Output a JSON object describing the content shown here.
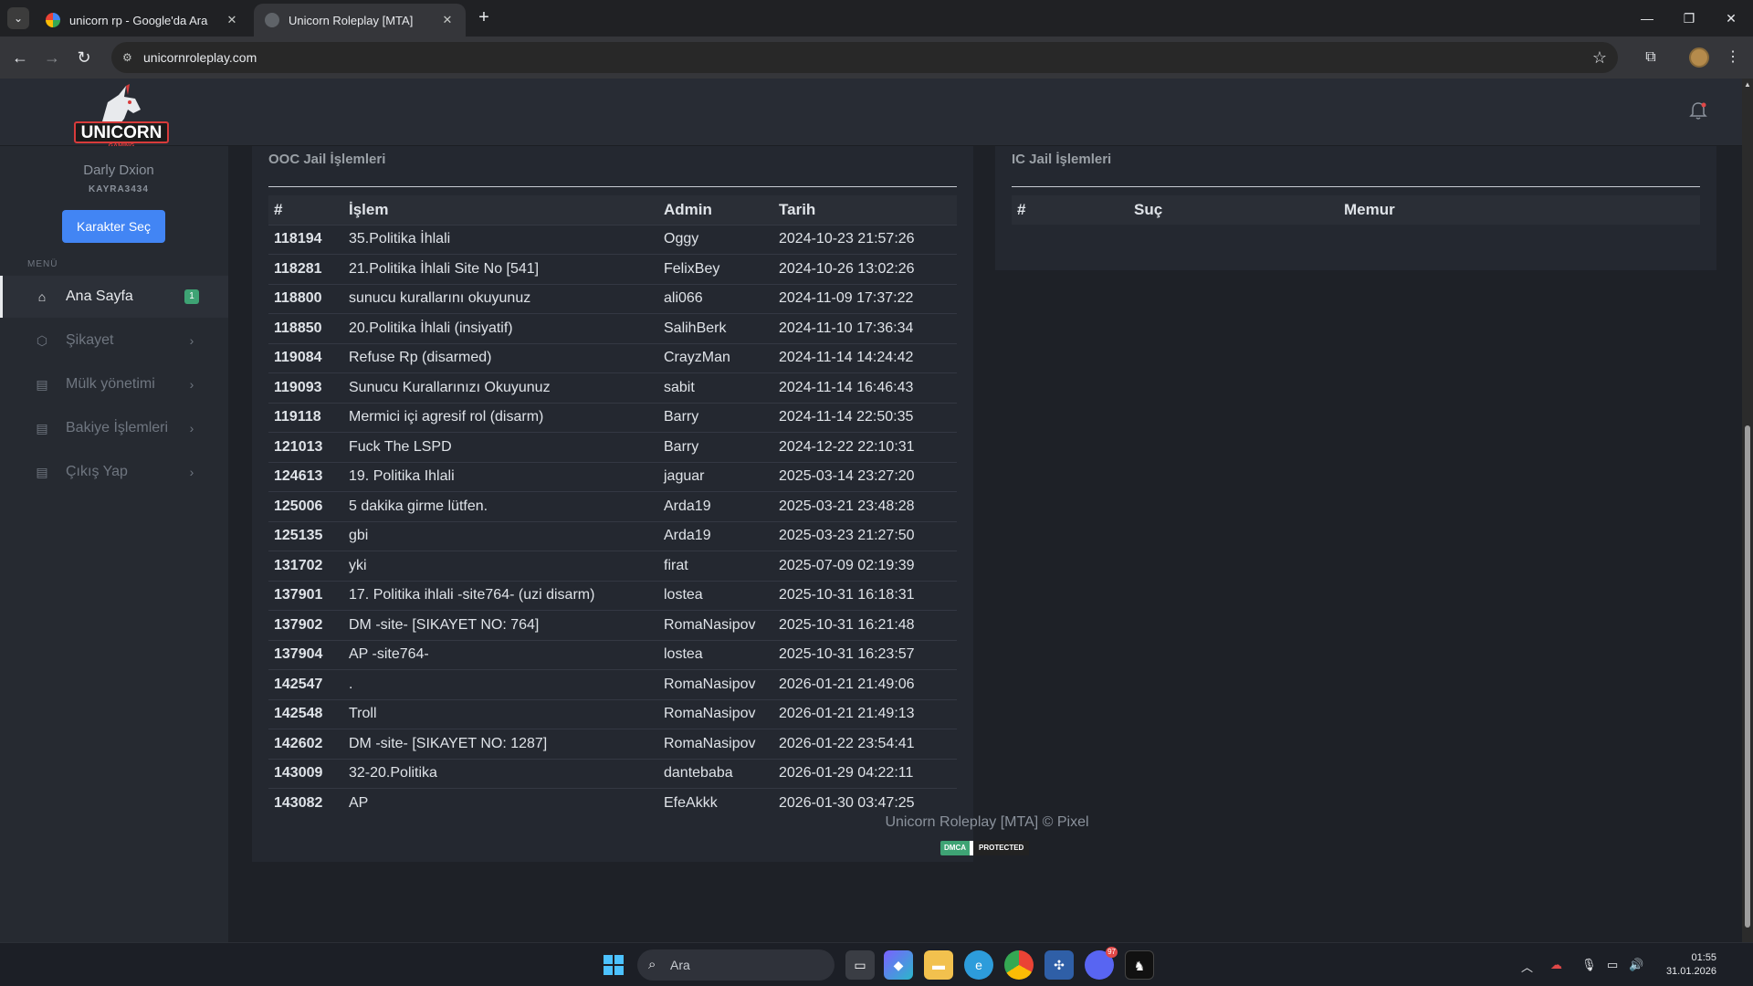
{
  "browser": {
    "tabs": [
      {
        "title": "unicorn rp - Google'da Ara",
        "active": false
      },
      {
        "title": "Unicorn Roleplay [MTA]",
        "active": true
      }
    ],
    "url": "unicornroleplay.com"
  },
  "sidebar": {
    "user_name": "Darly Dxion",
    "user_code": "KAYRA3434",
    "character_button": "Karakter Seç",
    "menu_label": "MENÜ",
    "items": [
      {
        "label": "Ana Sayfa",
        "icon": "home-icon",
        "badge": "1",
        "active": true
      },
      {
        "label": "Şikayet",
        "icon": "cube-icon",
        "active": false
      },
      {
        "label": "Mülk yönetimi",
        "icon": "document-icon",
        "active": false
      },
      {
        "label": "Bakiye İşlemleri",
        "icon": "document-icon",
        "active": false
      },
      {
        "label": "Çıkış Yap",
        "icon": "document-icon",
        "active": false
      }
    ]
  },
  "ooc_jail": {
    "title": "OOC Jail İşlemleri",
    "columns": [
      "#",
      "İşlem",
      "Admin",
      "Tarih"
    ],
    "rows": [
      [
        "118194",
        "35.Politika İhlali",
        "Oggy",
        "2024-10-23 21:57:26"
      ],
      [
        "118281",
        "21.Politika İhlali Site No [541]",
        "FelixBey",
        "2024-10-26 13:02:26"
      ],
      [
        "118800",
        "sunucu kurallarını okuyunuz",
        "ali066",
        "2024-11-09 17:37:22"
      ],
      [
        "118850",
        "20.Politika İhlali (insiyatif)",
        "SalihBerk",
        "2024-11-10 17:36:34"
      ],
      [
        "119084",
        "Refuse Rp (disarmed)",
        "CrayzMan",
        "2024-11-14 14:24:42"
      ],
      [
        "119093",
        "Sunucu Kurallarınızı Okuyunuz",
        "sabit",
        "2024-11-14 16:46:43"
      ],
      [
        "119118",
        "Mermici içi agresif rol (disarm)",
        "Barry",
        "2024-11-14 22:50:35"
      ],
      [
        "121013",
        "Fuck The LSPD",
        "Barry",
        "2024-12-22 22:10:31"
      ],
      [
        "124613",
        "19. Politika Ihlali",
        "jaguar",
        "2025-03-14 23:27:20"
      ],
      [
        "125006",
        "5 dakika girme lütfen.",
        "Arda19",
        "2025-03-21 23:48:28"
      ],
      [
        "125135",
        "gbi",
        "Arda19",
        "2025-03-23 21:27:50"
      ],
      [
        "131702",
        "yki",
        "firat",
        "2025-07-09 02:19:39"
      ],
      [
        "137901",
        "17. Politika ihlali -site764- (uzi disarm)",
        "lostea",
        "2025-10-31 16:18:31"
      ],
      [
        "137902",
        "DM -site- [SIKAYET NO: 764]",
        "RomaNasipov",
        "2025-10-31 16:21:48"
      ],
      [
        "137904",
        "AP -site764-",
        "lostea",
        "2025-10-31 16:23:57"
      ],
      [
        "142547",
        ".",
        "RomaNasipov",
        "2026-01-21 21:49:06"
      ],
      [
        "142548",
        "Troll",
        "RomaNasipov",
        "2026-01-21 21:49:13"
      ],
      [
        "142602",
        "DM -site- [SIKAYET NO: 1287]",
        "RomaNasipov",
        "2026-01-22 23:54:41"
      ],
      [
        "143009",
        "32-20.Politika",
        "dantebaba",
        "2026-01-29 04:22:11"
      ],
      [
        "143082",
        "AP",
        "EfeAkkk",
        "2026-01-30 03:47:25"
      ]
    ]
  },
  "ic_jail": {
    "title": "IC Jail İşlemleri",
    "columns": [
      "#",
      "Suç",
      "Memur"
    ]
  },
  "footer": {
    "text": "Unicorn Roleplay [MTA] © Pixel",
    "dmca_left": "DMCA",
    "dmca_right": "PROTECTED"
  },
  "taskbar": {
    "search_placeholder": "Ara",
    "time": "01:55",
    "date": "31.01.2026",
    "discord_badge": "97"
  },
  "colors": {
    "primary_button": "#4285f4",
    "badge_green": "#3ea374"
  }
}
